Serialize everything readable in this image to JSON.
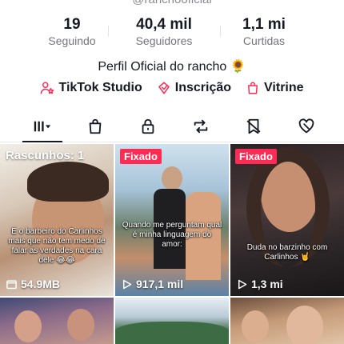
{
  "profile": {
    "handle": "@ranchooficial",
    "bio": "Perfil Oficial do rancho 🌻"
  },
  "stats": [
    {
      "value": "19",
      "label": "Seguindo"
    },
    {
      "value": "40,4 mil",
      "label": "Seguidores"
    },
    {
      "value": "1,1 mi",
      "label": "Curtidas"
    }
  ],
  "links": [
    {
      "label": "TikTok Studio",
      "icon": "user-star-icon"
    },
    {
      "label": "Inscrição",
      "icon": "subscription-icon"
    },
    {
      "label": "Vitrine",
      "icon": "shopping-bag-icon"
    }
  ],
  "tabs": [
    "videos-grid-icon",
    "shop-icon",
    "lock-icon",
    "repost-icon",
    "favorites-icon",
    "liked-icon"
  ],
  "videos": [
    {
      "badge": "",
      "draft_label": "Rascunhos: 1",
      "caption": "E o barbeiro do Carlinhos mais que não tem medo de falar as verdades na cara dele 😂😂",
      "meta": "54.9MB",
      "meta_icon": "folder-icon"
    },
    {
      "badge": "Fixado",
      "draft_label": "",
      "caption": "Quando me perguntam qual é minha linguagem do amor:",
      "meta": "917,1 mil",
      "meta_icon": "play-icon"
    },
    {
      "badge": "Fixado",
      "draft_label": "",
      "caption": "Duda no barzinho com Carlinhos 🤘",
      "meta": "1,3 mi",
      "meta_icon": "play-icon"
    }
  ],
  "colors": {
    "accent": "#fe2c55",
    "text": "#161823",
    "muted": "#75767b"
  }
}
